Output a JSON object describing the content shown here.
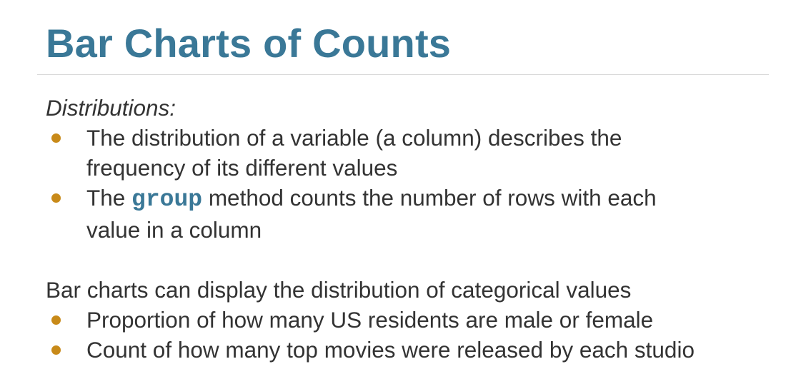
{
  "slide": {
    "title": "Bar Charts of Counts",
    "distributions_heading": "Distributions:",
    "distribution_bullets": {
      "item1_line1": "The distribution of a variable (a column) describes the",
      "item1_line2": "frequency of its different values",
      "item2_prefix": "The ",
      "item2_code": "group",
      "item2_suffix_line1": " method counts the number of rows with each",
      "item2_line2": "value in a column"
    },
    "barcharts_paragraph": "Bar charts can display the distribution of categorical values",
    "barchart_bullets": [
      "Proportion of how many US residents are male or female",
      "Count of how many top movies were released by each studio"
    ]
  },
  "colors": {
    "title": "#3a7897",
    "bullet": "#c88a19",
    "code": "#3a7897",
    "text": "#333333"
  }
}
